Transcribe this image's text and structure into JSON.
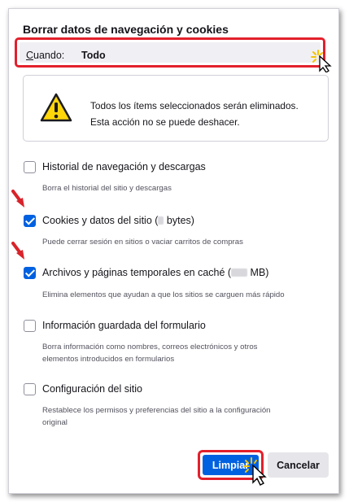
{
  "dialog": {
    "title": "Borrar datos de navegación y cookies",
    "when": {
      "label_first": "C",
      "label_rest": "uando:",
      "value": "Todo"
    },
    "warning": {
      "line1": "Todos los ítems seleccionados serán eliminados.",
      "line2": "Esta acción no se puede deshacer."
    },
    "options": [
      {
        "label": "Historial de navegación y descargas",
        "desc": [
          "Borra el historial del sitio y descargas"
        ],
        "checked": false
      },
      {
        "label_pre": "Cookies y datos del sitio (",
        "label_post": " bytes)",
        "desc": [
          "Puede cerrar sesión en sitios o vaciar carritos de compras"
        ],
        "checked": true
      },
      {
        "label_pre": "Archivos y páginas temporales en caché (",
        "label_post": " MB)",
        "desc": [
          "Elimina elementos que ayudan a que los sitios se carguen más rápido"
        ],
        "checked": true
      },
      {
        "label": "Información guardada del formulario",
        "desc": [
          "Borra información como nombres, correos electrónicos y otros",
          "elementos introducidos en formularios"
        ],
        "checked": false
      },
      {
        "label": "Configuración del sitio",
        "desc": [
          "Restablece los permisos y preferencias del sitio a la configuración",
          "original"
        ],
        "checked": false
      }
    ],
    "buttons": {
      "clear": "Limpiar",
      "cancel": "Cancelar"
    }
  },
  "colors": {
    "accent": "#0061e0",
    "highlight": "#e3202c",
    "annotation_arrow": "#d8232a",
    "warning_icon": "#ffd60a"
  },
  "icons": [
    "warning-icon",
    "checkbox-icon",
    "cursor-icon",
    "red-arrow-icon"
  ]
}
